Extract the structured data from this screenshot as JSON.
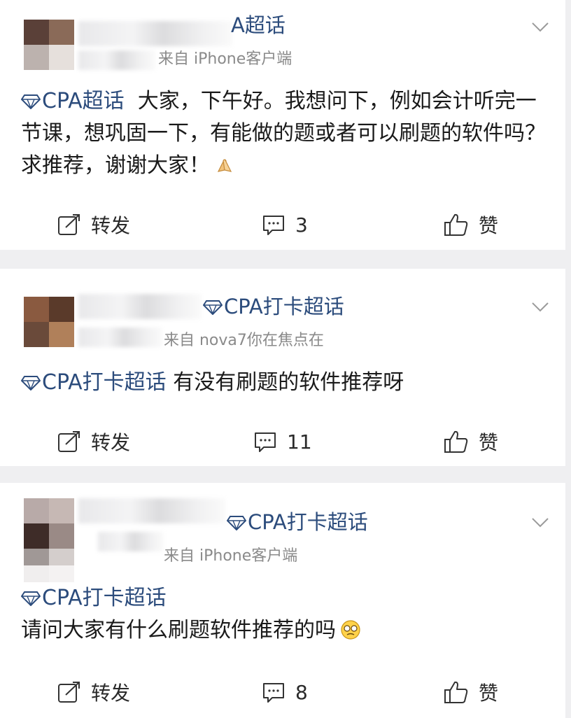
{
  "posts": [
    {
      "name_visible": "A超话",
      "source": "来自 iPhone客户端",
      "topic": "CPA超话",
      "body": "大家，下午好。我想问下，例如会计听完一节课，想巩固一下，有能做的题或者可以刷题的软件吗？求推荐，谢谢大家！",
      "emoji": "folded-hands-emoji",
      "repost_label": "转发",
      "comment_count": "3",
      "like_label": "赞"
    },
    {
      "name_visible": "CPA打卡超话",
      "source": "来自 nova7你在焦点在",
      "topic": "CPA打卡超话",
      "body": "有没有刷题的软件推荐呀",
      "repost_label": "转发",
      "comment_count": "11",
      "like_label": "赞"
    },
    {
      "name_visible": "CPA打卡超话",
      "source": "来自 iPhone客户端",
      "topic": "CPA打卡超话",
      "body": "请问大家有什么刷题软件推荐的吗",
      "emoji": "sweat-smile-emoji",
      "repost_label": "转发",
      "comment_count": "8",
      "like_label": "赞"
    }
  ],
  "colors": {
    "link": "#2c4c7c",
    "meta": "#8a8a8a",
    "separator": "#efeff1"
  },
  "icons": [
    "diamond-icon",
    "chevron-down-icon",
    "repost-icon",
    "comment-icon",
    "like-icon"
  ]
}
